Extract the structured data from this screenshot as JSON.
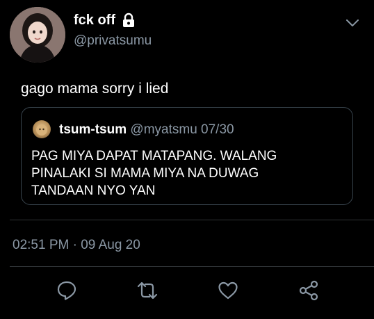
{
  "tweet": {
    "author": {
      "name": "fck off",
      "handle": "@privatsumu",
      "avatar_icon": "profile-photo",
      "protected": true
    },
    "text": "gago mama sorry i lied",
    "quoted_tweet": {
      "name": "tsum-tsum",
      "handle": "@myatsmu",
      "date": "07/30",
      "lines": [
        "PAG MIYA DAPAT MATAPANG. WALANG",
        "PINALAKI SI MAMA MIYA NA DUWAG",
        "TANDAAN NYO YAN"
      ]
    },
    "timestamp": "02:51 PM · 09 Aug 20"
  },
  "actions": {
    "items": [
      "reply-icon",
      "retweet-icon",
      "like-icon",
      "share-icon"
    ]
  },
  "colors": {
    "background": "#000000",
    "text": "#ffffff",
    "secondary": "#8b98a5",
    "border": "#38444d",
    "divider": "#2f3336"
  }
}
